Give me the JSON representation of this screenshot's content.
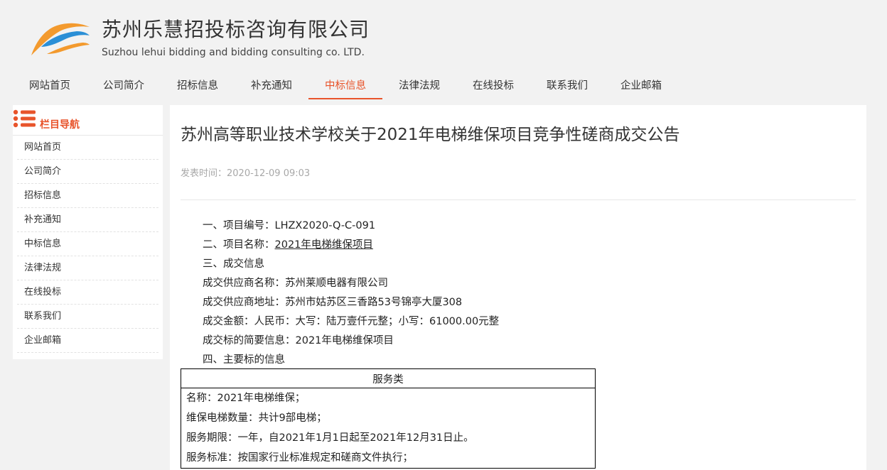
{
  "brand": {
    "name_cn": "苏州乐慧招投标咨询有限公司",
    "name_en": "Suzhou lehui bidding and bidding consulting co. LTD.",
    "logo_icon": "swoosh-logo",
    "colors": {
      "orange": "#f39a2e",
      "blue": "#2b8fd6",
      "accent": "#e8542b"
    }
  },
  "nav": {
    "items": [
      "网站首页",
      "公司简介",
      "招标信息",
      "补充通知",
      "中标信息",
      "法律法规",
      "在线投标",
      "联系我们",
      "企业邮箱"
    ],
    "active": "中标信息"
  },
  "sidebar": {
    "title": "栏目导航",
    "icon": "list-icon",
    "items": [
      "网站首页",
      "公司简介",
      "招标信息",
      "补充通知",
      "中标信息",
      "法律法规",
      "在线投标",
      "联系我们",
      "企业邮箱"
    ]
  },
  "article": {
    "title": "苏州高等职业技术学校关于2021年电梯维保项目竞争性磋商成交公告",
    "publish_label": "发表时间：",
    "publish_time": "2020-12-09 09:03",
    "lines": {
      "l1": "一、项目编号：LHZX2020-Q-C-091",
      "l2_prefix": "二、项目名称：",
      "l2_value": "2021年电梯维保项目",
      "l3": "三、成交信息",
      "l4": "成交供应商名称：苏州莱顺电器有限公司",
      "l5": "成交供应商地址：苏州市姑苏区三香路53号锦亭大厦308",
      "l6": "成交金额：人民币：大写：陆万壹仟元整；小写：61000.00元整",
      "l7": "成交标的简要信息：2021年电梯维保项目",
      "l8": "四、主要标的信息"
    },
    "service_table": {
      "header": "服务类",
      "rows": [
        "名称：2021年电梯维保；",
        "维保电梯数量：共计9部电梯；",
        "服务期限：一年，自2021年1月1日起至2021年12月31日止。",
        "服务标准：按国家行业标准规定和磋商文件执行；"
      ]
    }
  }
}
